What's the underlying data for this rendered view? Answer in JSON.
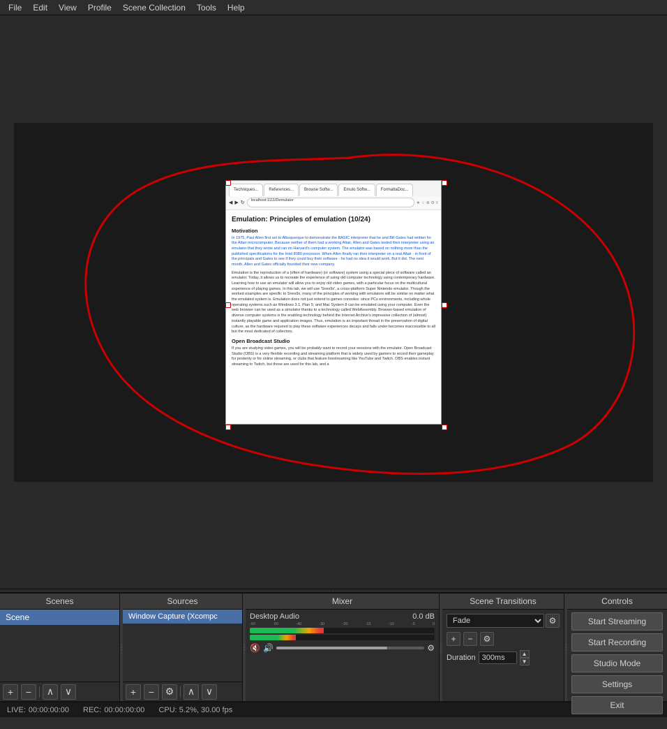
{
  "menu": {
    "items": [
      "File",
      "Edit",
      "View",
      "Profile",
      "Scene Collection",
      "Tools",
      "Help"
    ]
  },
  "preview": {
    "browser_window": {
      "tabs": [
        "Techniques...",
        "References...",
        "Browse Softw...",
        "Emulo Softw...",
        "FormattaDoc..."
      ],
      "address": "localhost:1111/Demulator",
      "title": "Emulation: Principles of emulation (10/24)",
      "section1_heading": "Motivation",
      "section1_text": "In 1975, Paul Allen first set to Albuquerque to demonstrate the BASIC interpreter that he and Bill Gates had written for the Altair microcomputer. Because neither of them had a working Altair, Allen and Gates tested their interpreter using an emulator that they wrote and ran on Harvard's computer system. The emulator was based on nothing more than the published specifications for the Intel 8080 processor. When Allen finally ran their interpreter on a real Altair - in front of the principals and Gates to see if they could buy their software - he had no idea it would work. But it did. The next month, Allen and Gates officially founded their new company.",
      "section2_text": "Emulation is the reproduction of a (often of hardware) (or software) system using a special piece of software called an emulator. Today, it allows us to recreate the experience of using old computer technology using contemporary hardware. Learning how to use an emulator will allow you to enjoy old video games, with a particular focus on the multicultural experience of playing games. In this lab, we will use 'Snes9x', a cross-platform Super Nintendo emulator. Though the worked examples are specific to Snes9x, many of the principles of working with emulators will be similar no matter what the emulated system is. Emulation does not just extend to games consoles: since PCs environments, including whole operating systems such as Windows 3.1, Plan 9, and Mac System 8 can be emulated using your computer. Even the web browser can be used as a simulator thanks to a technology called WebAssembly. Browser-based emulation of diverse computer systems is the enabling technology behind the Internet Archive's impressive collection of (almost) instantly playable game and application images. Thus, emulation is an important thread in the preservation of digital culture, as the hardware required to play these software experiences decays and falls under becomes inaccessible to all but the most dedicated of collectors.",
      "section3_heading": "Open Broadcast Studio",
      "section3_text": "If you are studying video games, you will be probably want to record your sessions with the emulator. Open Broadcast Studio (OBS) is a very flexible recording and streaming platform that is widely used by gamers to record their gameplay for posterity or for online streaming, or clubs that feature livestreaming like YouTube and Twitch. OBS enables instant streaming to Twitch, but those are used for this lab, and a"
    }
  },
  "panels": {
    "scenes": {
      "header": "Scenes",
      "items": [
        "Scene"
      ]
    },
    "sources": {
      "header": "Sources",
      "items": [
        "Window Capture (Xcompc"
      ]
    },
    "mixer": {
      "header": "Mixer",
      "tracks": [
        {
          "name": "Desktop Audio",
          "db": "0.0 dB",
          "scale": [
            "-60",
            "-50",
            "-40",
            "-30",
            "-20",
            "-15",
            "-10",
            "-5",
            "0"
          ],
          "volume_pct": 75
        }
      ]
    },
    "transitions": {
      "header": "Scene Transitions",
      "transition_type": "Fade",
      "duration_label": "Duration",
      "duration_value": "300ms"
    },
    "controls": {
      "header": "Controls",
      "buttons": {
        "start_streaming": "Start Streaming",
        "start_recording": "Start Recording",
        "studio_mode": "Studio Mode",
        "settings": "Settings",
        "exit": "Exit"
      }
    }
  },
  "status_bar": {
    "live_label": "LIVE:",
    "live_time": "00:00:00:00",
    "rec_label": "REC:",
    "rec_time": "00:00:00:00",
    "cpu_label": "CPU: 5.2%, 30.00 fps"
  },
  "toolbar": {
    "add_icon": "+",
    "remove_icon": "−",
    "settings_icon": "⚙",
    "up_icon": "∧",
    "down_icon": "∨"
  }
}
